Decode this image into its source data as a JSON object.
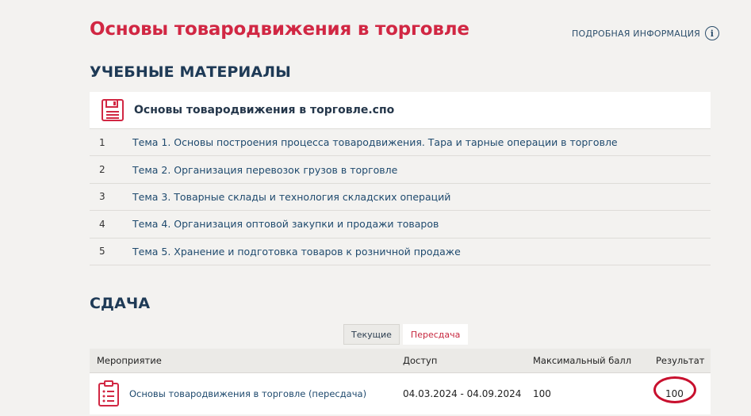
{
  "course": {
    "title": "Основы товародвижения в торговле",
    "more_info_label": "ПОДРОБНАЯ ИНФОРМАЦИЯ"
  },
  "materials": {
    "section_title": "УЧЕБНЫЕ МАТЕРИАЛЫ",
    "file_name": "Основы товародвижения в торговле.спо",
    "topics": [
      {
        "num": "1",
        "label": "Тема 1. Основы построения процесса товародвижения. Тара и тарные операции в торговле"
      },
      {
        "num": "2",
        "label": "Тема 2. Организация перевозок грузов в торговле"
      },
      {
        "num": "3",
        "label": "Тема 3. Товарные склады и технология складских операций"
      },
      {
        "num": "4",
        "label": "Тема 4. Организация оптовой закупки и продажи товаров"
      },
      {
        "num": "5",
        "label": "Тема 5. Хранение и подготовка товаров к розничной продаже"
      }
    ]
  },
  "submission": {
    "section_title": "СДАЧА",
    "tabs": [
      {
        "label": "Текущие",
        "active": false
      },
      {
        "label": "Пересдача",
        "active": true
      }
    ],
    "table": {
      "headers": {
        "event": "Мероприятие",
        "access": "Доступ",
        "max_score": "Максимальный балл",
        "result": "Результат"
      },
      "rows": [
        {
          "event": "Основы товародвижения в торговле (пересдача)",
          "access": "04.03.2024 - 04.09.2024",
          "max_score": "100",
          "result": "100"
        }
      ]
    }
  },
  "colors": {
    "accent_red": "#d12743",
    "navy": "#1e3a56",
    "link": "#1f4a6e",
    "annotation_red": "#c8102e"
  }
}
